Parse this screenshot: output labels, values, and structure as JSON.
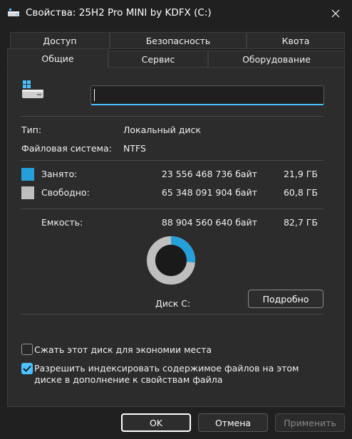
{
  "window": {
    "title": "Свойства: 25H2 Pro MINI by KDFX (C:)"
  },
  "tabs": {
    "row_back": [
      "Доступ",
      "Безопасность",
      "Квота"
    ],
    "row_front": [
      "Общие",
      "Сервис",
      "Оборудование"
    ],
    "active": "Общие"
  },
  "general": {
    "name_value": "",
    "type_label": "Тип:",
    "type_value": "Локальный диск",
    "fs_label": "Файловая система:",
    "fs_value": "NTFS",
    "used_label": "Занято:",
    "used_bytes": "23 556 468 736 байт",
    "used_short": "21,9 ГБ",
    "free_label": "Свободно:",
    "free_bytes": "65 348 091 904 байт",
    "free_short": "60,8 ГБ",
    "capacity_label": "Емкость:",
    "capacity_bytes": "88 904 560 640 байт",
    "capacity_short": "82,7 ГБ",
    "used_fraction": 0.265,
    "used_color": "#26a0da",
    "free_color": "#bfbfbf",
    "disk_label": "Диск C:",
    "details_button": "Подробно",
    "compress_label": "Сжать этот диск для экономии места",
    "compress_checked": false,
    "index_label_line1": "Разрешить индексировать содержимое файлов на этом",
    "index_label_line2": "диске в дополнение к свойствам файла",
    "index_checked": true
  },
  "footer": {
    "ok": "OK",
    "cancel": "Отмена",
    "apply": "Применить"
  }
}
